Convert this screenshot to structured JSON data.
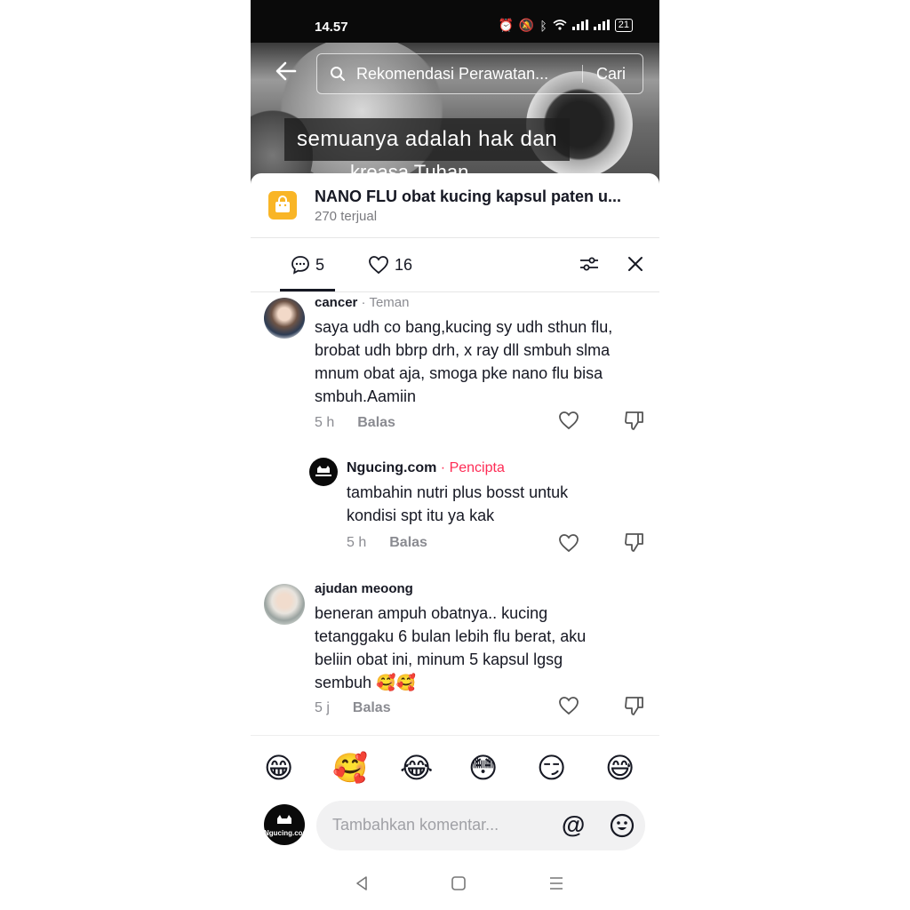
{
  "status_bar": {
    "time": "14.57",
    "battery": "21"
  },
  "search": {
    "query": "Rekomendasi Perawatan...",
    "button": "Cari"
  },
  "video": {
    "caption_line1": "semuanya adalah hak dan",
    "caption_line2": "kreasa Tuhan"
  },
  "product": {
    "title": "NANO FLU obat kucing kapsul paten u...",
    "sold": "270 terjual"
  },
  "tabs": {
    "comments_count": "5",
    "likes_count": "16"
  },
  "comments": [
    {
      "user": "cancer",
      "relation": "· Teman",
      "text": [
        "saya udh co bang,kucing sy udh sthun flu,",
        "brobat udh bbrp drh, x ray dll smbuh slma",
        "mnum obat aja, smoga pke nano flu bisa",
        "smbuh.Aamiin"
      ],
      "time": "5 h",
      "reply_label": "Balas"
    },
    {
      "user": "Ngucing.com",
      "relation": "· Pencipta",
      "text": [
        "tambahin nutri plus bosst untuk",
        "kondisi spt itu ya kak"
      ],
      "time": "5 h",
      "reply_label": "Balas"
    },
    {
      "user": "ajudan meoong",
      "relation": "",
      "text": [
        "beneran ampuh obatnya.. kucing",
        "tetanggaku 6 bulan lebih flu berat, aku",
        "beliin obat ini, minum 5 kapsul lgsg",
        "sembuh 🥰🥰"
      ],
      "time": "5 j",
      "reply_label": "Balas"
    }
  ],
  "emojis": [
    "😁",
    "🥰",
    "😂",
    "😳",
    "😏",
    "😅"
  ],
  "input": {
    "placeholder": "Tambahkan komentar...",
    "at_symbol": "@",
    "avatar_text": "Ngucing.com"
  },
  "colors": {
    "accent": "#fe2c55",
    "shop_bag": "#f9b526"
  }
}
